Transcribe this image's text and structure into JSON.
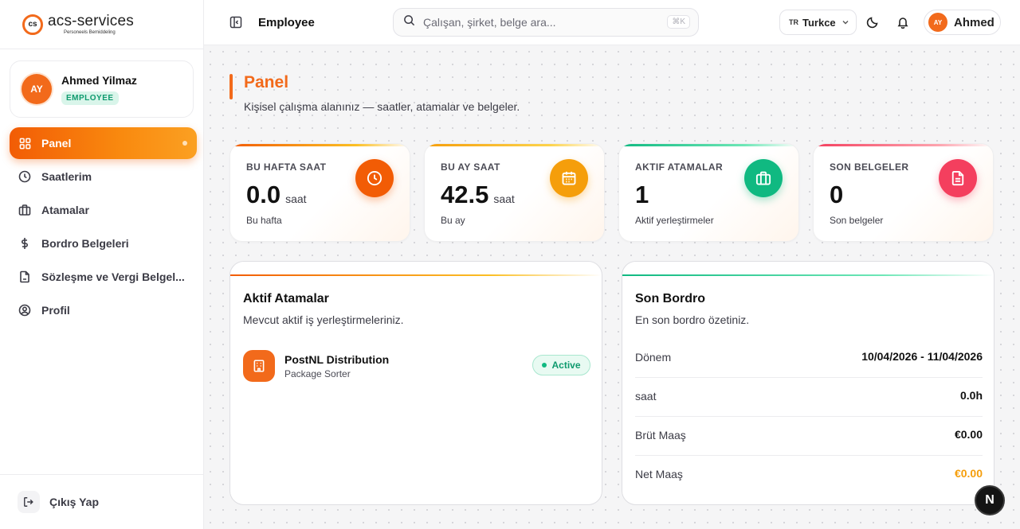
{
  "brand": {
    "name": "acs-services",
    "tagline": "Personeels Bemiddeling",
    "mark": "cs"
  },
  "user": {
    "name": "Ahmed Yilmaz",
    "initials": "AY",
    "role": "EMPLOYEE",
    "first_name": "Ahmed"
  },
  "nav": {
    "items": [
      {
        "label": "Panel",
        "icon": "grid-icon",
        "active": true
      },
      {
        "label": "Saatlerim",
        "icon": "clock-icon"
      },
      {
        "label": "Atamalar",
        "icon": "briefcase-icon"
      },
      {
        "label": "Bordro Belgeleri",
        "icon": "dollar-icon"
      },
      {
        "label": "Sözleşme ve Vergi Belgel...",
        "icon": "file-icon"
      },
      {
        "label": "Profil",
        "icon": "user-circle-icon"
      }
    ],
    "logout": "Çıkış Yap"
  },
  "topbar": {
    "crumb": "Employee",
    "search_placeholder": "Çalışan, şirket, belge ara...",
    "shortcut": "⌘K",
    "lang_code": "TR",
    "lang_label": "Turkce"
  },
  "page": {
    "title": "Panel",
    "subtitle": "Kişisel çalışma alanınız — saatler, atamalar ve belgeler."
  },
  "stats": [
    {
      "label": "BU HAFTA SAAT",
      "value": "0.0",
      "unit": "saat",
      "caption": "Bu hafta",
      "icon": "clock-icon",
      "color": "#f25c05"
    },
    {
      "label": "BU AY SAAT",
      "value": "42.5",
      "unit": "saat",
      "caption": "Bu ay",
      "icon": "calendar-icon",
      "color": "#f59e0b"
    },
    {
      "label": "AKTIF ATAMALAR",
      "value": "1",
      "unit": "",
      "caption": "Aktif yerleştirmeler",
      "icon": "briefcase-icon",
      "color": "#10b981"
    },
    {
      "label": "SON BELGELER",
      "value": "0",
      "unit": "",
      "caption": "Son belgeler",
      "icon": "document-icon",
      "color": "#f43f5e"
    }
  ],
  "assignments": {
    "title": "Aktif Atamalar",
    "subtitle": "Mevcut aktif iş yerleştirmeleriniz.",
    "items": [
      {
        "company": "PostNL Distribution",
        "role": "Package Sorter",
        "status": "Active"
      }
    ]
  },
  "payroll": {
    "title": "Son Bordro",
    "subtitle": "En son bordro özetiniz.",
    "rows": [
      {
        "label": "Dönem",
        "value": "10/04/2026 - 11/04/2026"
      },
      {
        "label": "saat",
        "value": "0.0h"
      },
      {
        "label": "Brüt Maaş",
        "value": "€0.00"
      },
      {
        "label": "Net Maaş",
        "value": "€0.00",
        "highlight": "#f59e0b"
      }
    ]
  },
  "fab_label": "N"
}
